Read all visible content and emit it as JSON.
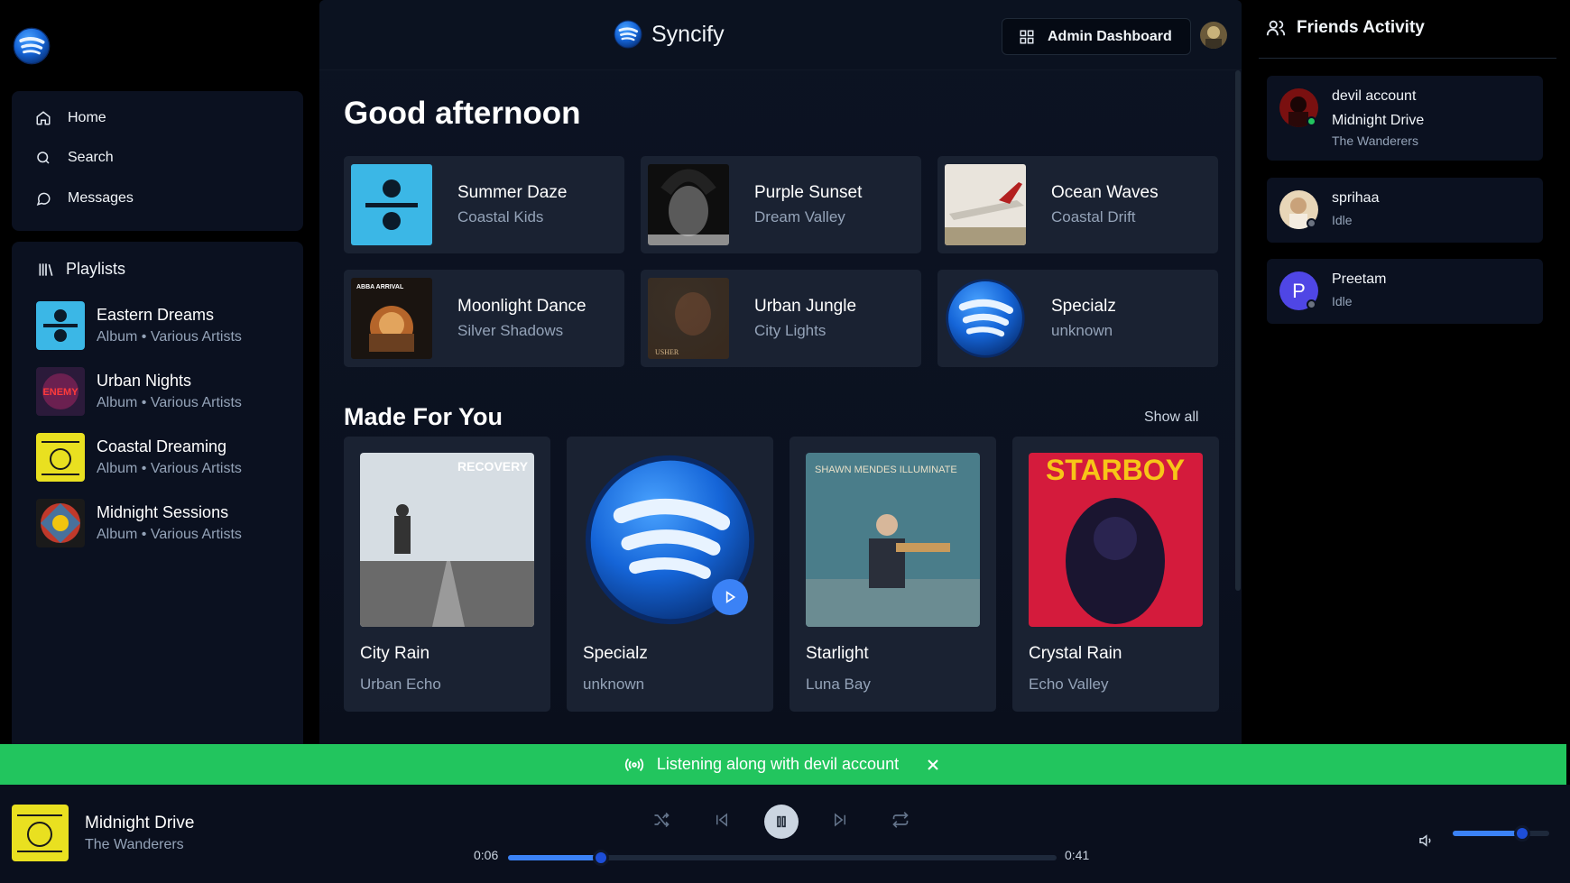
{
  "app": {
    "name": "Syncify"
  },
  "sidebar": {
    "nav": [
      {
        "label": "Home",
        "icon": "home-icon"
      },
      {
        "label": "Search",
        "icon": "search-icon"
      },
      {
        "label": "Messages",
        "icon": "message-icon"
      }
    ],
    "playlists_heading": "Playlists",
    "playlists": [
      {
        "title": "Eastern Dreams",
        "sub": "Album • Various Artists"
      },
      {
        "title": "Urban Nights",
        "sub": "Album • Various Artists"
      },
      {
        "title": "Coastal Dreaming",
        "sub": "Album • Various Artists"
      },
      {
        "title": "Midnight Sessions",
        "sub": "Album • Various Artists"
      }
    ]
  },
  "header": {
    "admin_label": "Admin Dashboard"
  },
  "main": {
    "greeting": "Good afternoon",
    "quick": [
      {
        "title": "Summer Daze",
        "artist": "Coastal Kids"
      },
      {
        "title": "Purple Sunset",
        "artist": "Dream Valley"
      },
      {
        "title": "Ocean Waves",
        "artist": "Coastal Drift"
      },
      {
        "title": "Moonlight Dance",
        "artist": "Silver Shadows"
      },
      {
        "title": "Urban Jungle",
        "artist": "City Lights"
      },
      {
        "title": "Specialz",
        "artist": "unknown"
      }
    ],
    "made_for_you": {
      "title": "Made For You",
      "show_all": "Show all",
      "items": [
        {
          "title": "City Rain",
          "artist": "Urban Echo"
        },
        {
          "title": "Specialz",
          "artist": "unknown"
        },
        {
          "title": "Starlight",
          "artist": "Luna Bay"
        },
        {
          "title": "Crystal Rain",
          "artist": "Echo Valley"
        }
      ]
    },
    "art_text": {
      "recovery": "RECOVERY",
      "illuminate": "SHAWN MENDES ILLUMINATE",
      "starboy": "STARBOY",
      "abba": "ABBA ARRIVAL",
      "usher": "USHER",
      "enemy": "ENEMY"
    }
  },
  "friends": {
    "heading": "Friends Activity",
    "list": [
      {
        "name": "devil account",
        "song": "Midnight Drive",
        "artist": "The Wanderers",
        "status_color": "#22c55e"
      },
      {
        "name": "sprihaa",
        "status": "Idle",
        "status_color": "#6b7280"
      },
      {
        "name": "Preetam",
        "status": "Idle",
        "initial": "P",
        "status_color": "#6b7280"
      }
    ]
  },
  "listen_along": {
    "text": "Listening along with devil account"
  },
  "player": {
    "title": "Midnight Drive",
    "artist": "The Wanderers",
    "current_time": "0:06",
    "total_time": "0:41",
    "progress": 0.17,
    "volume": 0.72
  },
  "colors": {
    "accent": "#3b82f6",
    "listen_bar": "#22c55e",
    "panel": "#0b1120",
    "card": "#1a2232"
  }
}
